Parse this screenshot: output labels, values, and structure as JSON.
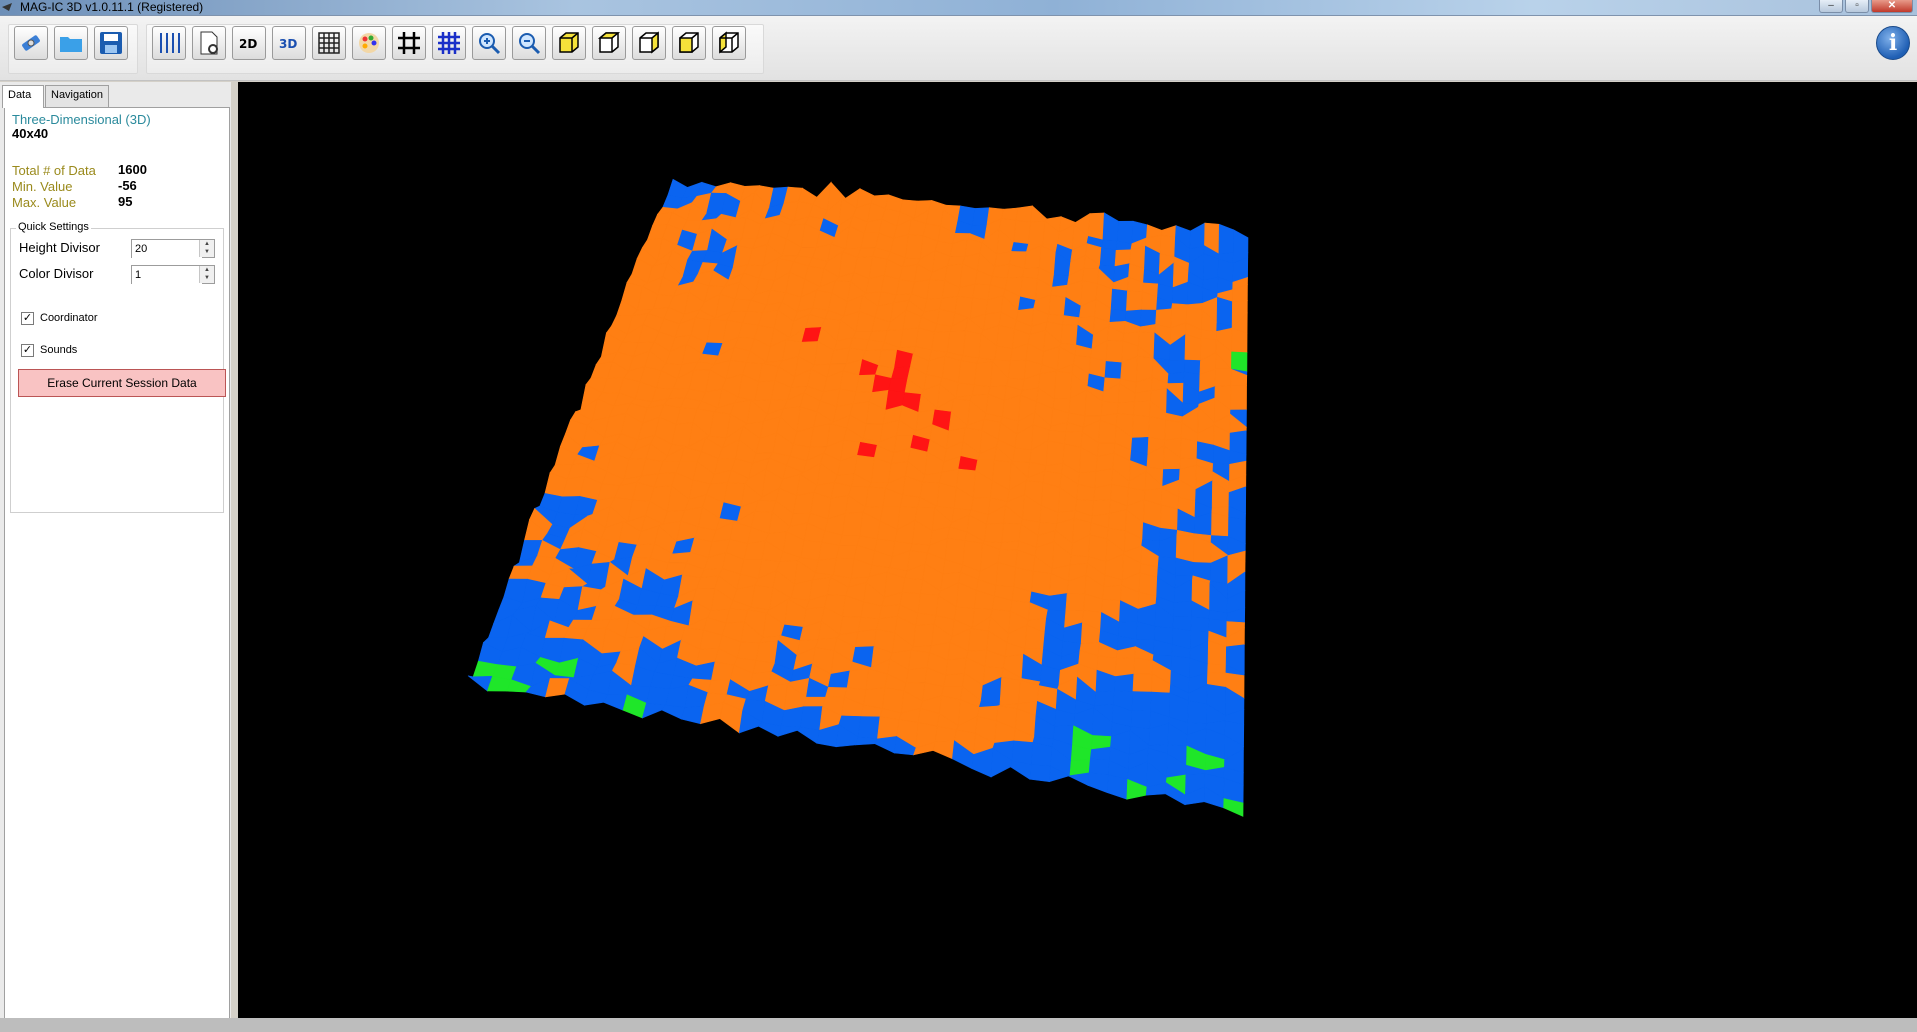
{
  "window": {
    "title": "MAG-IC 3D v1.0.11.1 (Registered)"
  },
  "toolbar": {
    "buttons": [
      {
        "icon": "satellite-icon"
      },
      {
        "icon": "folder-open-icon"
      },
      {
        "icon": "save-icon"
      },
      {
        "icon": "arrows-vertical-icon"
      },
      {
        "icon": "document-search-icon"
      },
      {
        "icon": "view-2d-icon",
        "label": "2D"
      },
      {
        "icon": "view-3d-icon",
        "label": "3D"
      },
      {
        "icon": "grid-icon"
      },
      {
        "icon": "palette-icon"
      },
      {
        "icon": "hash-grid-icon"
      },
      {
        "icon": "hash-grid-blue-icon"
      },
      {
        "icon": "zoom-in-icon"
      },
      {
        "icon": "zoom-out-icon"
      },
      {
        "icon": "cube-view-1-icon"
      },
      {
        "icon": "cube-view-2-icon"
      },
      {
        "icon": "cube-view-3-icon"
      },
      {
        "icon": "cube-view-4-icon"
      },
      {
        "icon": "cube-view-5-icon"
      }
    ]
  },
  "tabs": [
    "Data",
    "Navigation"
  ],
  "data_panel": {
    "mode": "Three-Dimensional (3D)",
    "dims": "40x40",
    "stats": [
      {
        "label": "Total # of Data",
        "value": "1600"
      },
      {
        "label": "Min. Value",
        "value": "-56"
      },
      {
        "label": "Max. Value",
        "value": "95"
      }
    ],
    "quick_settings": {
      "title": "Quick Settings",
      "height_divisor": {
        "label": "Height Divisor",
        "value": "20"
      },
      "color_divisor": {
        "label": "Color Divisor",
        "value": "1"
      },
      "coordinator": {
        "label": "Coordinator",
        "checked": true
      },
      "sounds": {
        "label": "Sounds",
        "checked": true
      },
      "erase_button": "Erase Current Session Data"
    }
  },
  "surface": {
    "rows": 40,
    "cols": 40,
    "min": -56,
    "max": 95,
    "palette": [
      "#2a1a6e",
      "#0a64f0",
      "#1fe629",
      "#ff7f13",
      "#ff1414"
    ]
  }
}
